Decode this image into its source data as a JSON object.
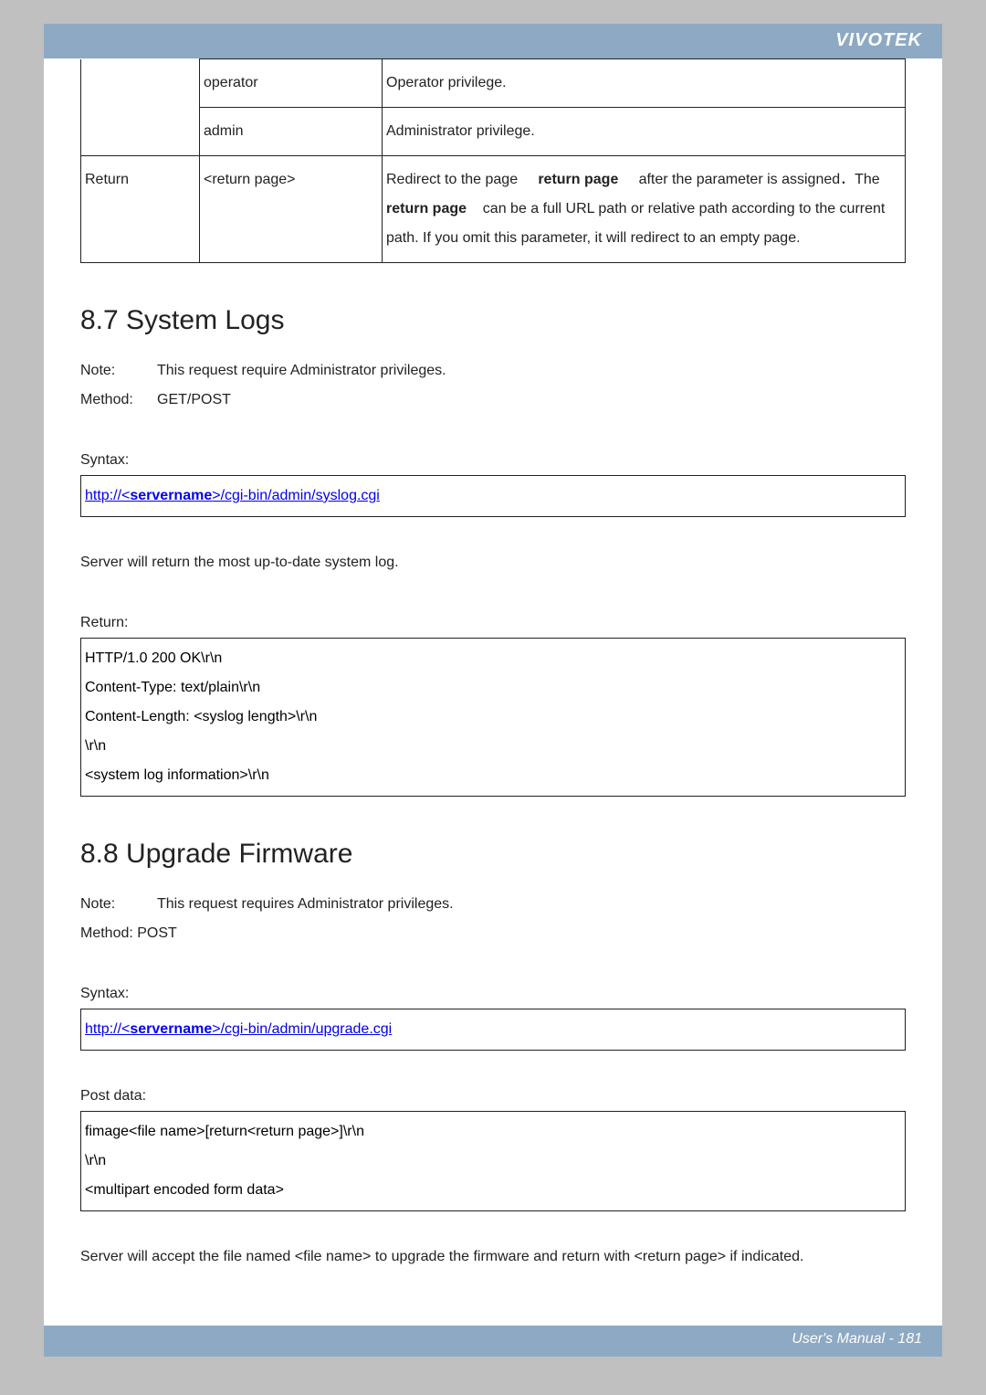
{
  "header": {
    "brand": "VIVOTEK"
  },
  "table1": {
    "row1": {
      "c2": "operator",
      "c3": "Operator privilege."
    },
    "row2": {
      "c2": "admin",
      "c3": "Administrator privilege."
    },
    "row3": {
      "c1": "Return",
      "c2": "<return page>",
      "c3_pre": "Redirect to the page ",
      "c3_bold1": "return page",
      "c3_mid1": " after the parameter is assigned．The ",
      "c3_bold2": "return page",
      "c3_tail": " can be a full URL path or relative path according to the current path. If you omit this parameter, it will redirect to an empty page."
    }
  },
  "s87": {
    "heading": "8.7 System Logs",
    "note_label": "Note:",
    "note_text": "This request require Administrator privileges.",
    "method_label": "Method:",
    "method_text": "GET/POST",
    "syntax_label": "Syntax:",
    "url_pre": "http://<",
    "url_bold": "servername",
    "url_post": ">/cgi-bin/admin/syslog.cgi",
    "desc": "Server will return the most up-to-date system log.",
    "return_label": "Return:",
    "return_body": "HTTP/1.0 200 OK\\r\\n\nContent-Type: text/plain\\r\\n\nContent-Length: <syslog length>\\r\\n\n\\r\\n\n<system log information>\\r\\n"
  },
  "s88": {
    "heading": "8.8 Upgrade Firmware",
    "note_label": "Note:",
    "note_text": "This request requires Administrator privileges.",
    "method_line": "Method: POST",
    "syntax_label": "Syntax:",
    "url_pre": "http://<",
    "url_bold": "servername",
    "url_post": ">/cgi-bin/admin/upgrade.cgi",
    "post_label": "Post data:",
    "post_body": "fimage<file name>[return<return page>]\\r\\n\n\\r\\n\n<multipart encoded form data>",
    "closing": "Server will accept the file named <file name> to upgrade the firmware and return with <return page> if indicated."
  },
  "footer": {
    "text": "User's Manual - 181"
  }
}
